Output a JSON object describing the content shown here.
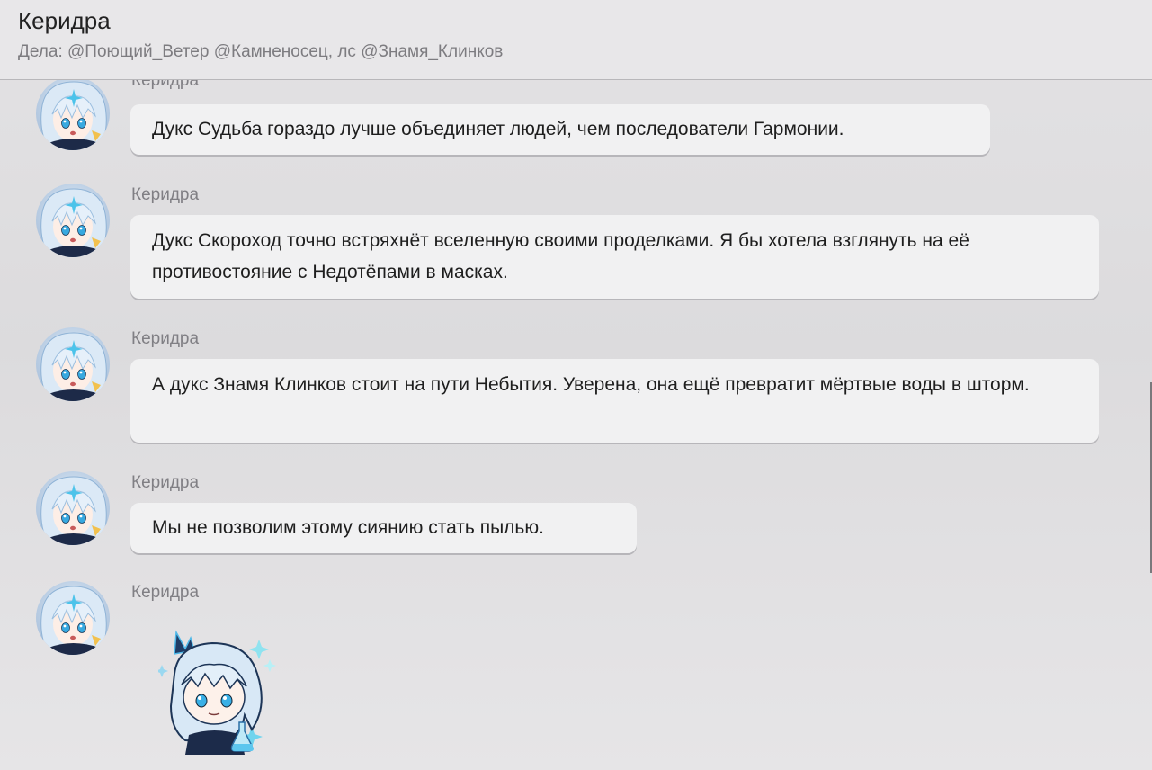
{
  "header": {
    "title": "Керидра",
    "subtitle": "Дела: @Поющий_Ветер @Камненосец, лс @Знамя_Клинков"
  },
  "messages": [
    {
      "sender": "Керидра",
      "text": "Дукс Судьба гораздо лучше объединяет людей, чем последователи Гармонии."
    },
    {
      "sender": "Керидра",
      "text": "Дукс Скороход точно встряхнёт вселенную своими проделками. Я бы хотела взглянуть на её противостояние с Недотёпами в масках."
    },
    {
      "sender": "Керидра",
      "text": "А дукс Знамя Клинков стоит на пути Небытия. Уверена, она ещё превратит мёртвые воды в шторм."
    },
    {
      "sender": "Керидра",
      "text": "Мы не позволим этому сиянию стать пылью."
    },
    {
      "sender": "Керидра",
      "sticker": "keridra-chibi-sticker"
    }
  ],
  "icons": {
    "avatar": "keridra-avatar-icon",
    "sticker": "keridra-sticker-icon"
  },
  "colors": {
    "bubble": "#f1f1f2",
    "hair": "#cfe3f5",
    "accent": "#3ab0e6"
  }
}
